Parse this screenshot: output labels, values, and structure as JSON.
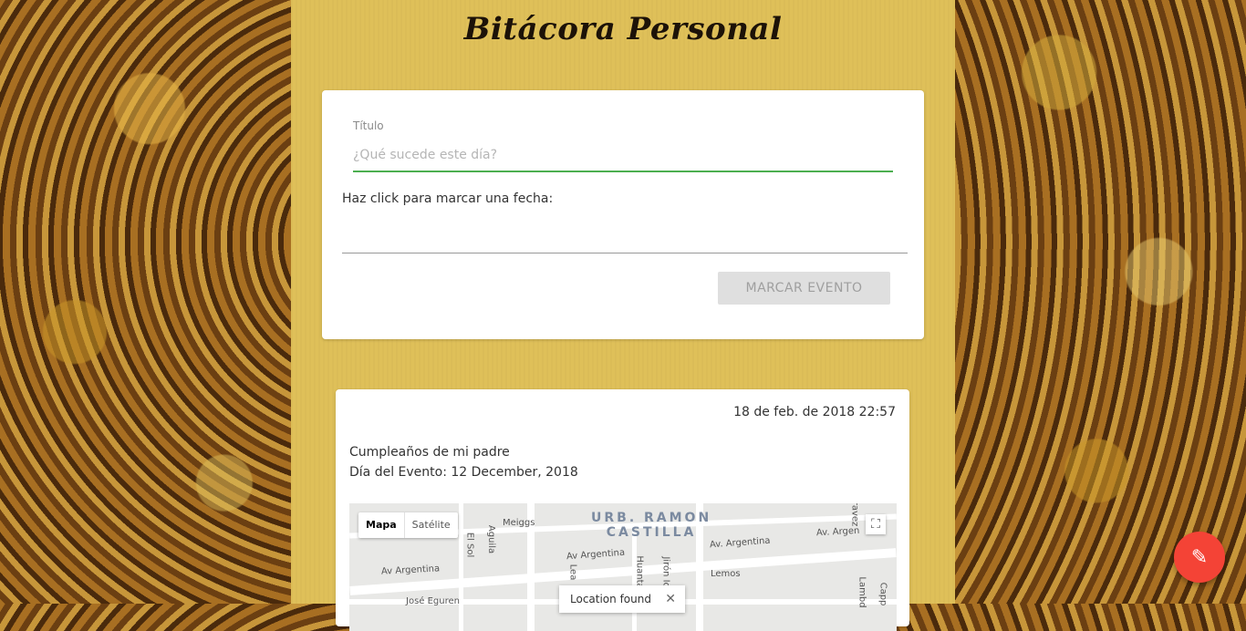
{
  "app": {
    "title": "Bitácora Personal"
  },
  "form": {
    "title_label": "Título",
    "title_placeholder": "¿Qué sucede este día?",
    "date_label": "Haz click para marcar una fecha:",
    "submit_label": "MARCAR EVENTO"
  },
  "events": [
    {
      "timestamp": "18 de feb. de 2018 22:57",
      "title": "Cumpleaños de mi padre",
      "event_date": "Día del Evento: 12 December, 2018",
      "map": {
        "type_options": [
          "Mapa",
          "Satélite"
        ],
        "area_label_line1": "URB. RAMON",
        "area_label_line2": "CASTILLA",
        "streets": [
          "Av Argentina",
          "Av. Argentina",
          "Av Argentina",
          "Av. Argen",
          "Meiggs",
          "Aguila",
          "El Sol",
          "Lemos",
          "José Eguren",
          "Huanta",
          "Jirón Io",
          "Lambd",
          "Capp",
          "Lea",
          "ravez"
        ],
        "toast": "Location found"
      }
    }
  ],
  "colors": {
    "accent": "#4caf50",
    "fab": "#f44336",
    "column": "#dfc059"
  },
  "icons": {
    "fab": "pencil-icon",
    "fullscreen": "fullscreen-icon",
    "close": "close-icon"
  }
}
